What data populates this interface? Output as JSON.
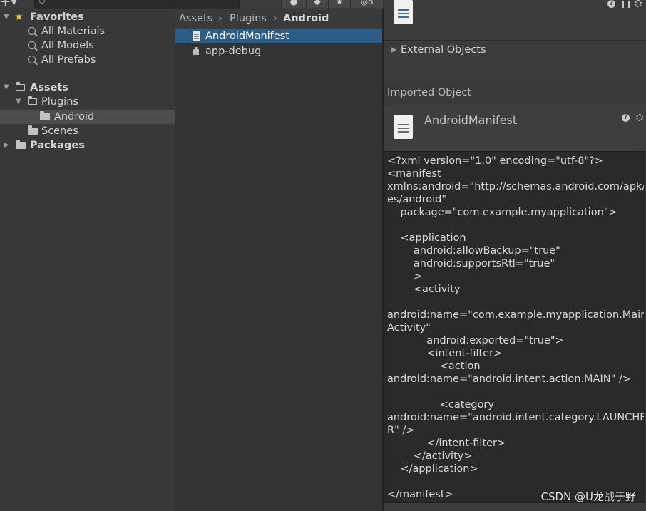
{
  "toolbar": {
    "add_label": "+▾",
    "hidden_count": "8"
  },
  "tree": {
    "favorites": {
      "label": "Favorites",
      "items": [
        "All Materials",
        "All Models",
        "All Prefabs"
      ]
    },
    "assets": {
      "label": "Assets",
      "plugins": "Plugins",
      "android": "Android",
      "scenes": "Scenes"
    },
    "packages": "Packages"
  },
  "breadcrumb": [
    "Assets",
    "Plugins",
    "Android"
  ],
  "files": [
    {
      "name": "AndroidManifest",
      "icon": "document-icon",
      "selected": true
    },
    {
      "name": "app-debug",
      "icon": "package-icon",
      "selected": false
    }
  ],
  "inspector": {
    "external_objects": "External Objects",
    "imported_object": "Imported Object",
    "asset_name": "AndroidManifest",
    "code_lines": [
      "<?xml version=\"1.0\" encoding=\"utf-8\"?>",
      "<manifest",
      "xmlns:android=\"http://schemas.android.com/apk/r",
      "es/android\"",
      "    package=\"com.example.myapplication\">",
      "",
      "    <application",
      "        android:allowBackup=\"true\"",
      "        android:supportsRtl=\"true\"",
      "        >",
      "        <activity",
      "",
      "android:name=\"com.example.myapplication.Main",
      "Activity\"",
      "            android:exported=\"true\">",
      "            <intent-filter>",
      "                <action",
      "android:name=\"android.intent.action.MAIN\" />",
      "",
      "                <category",
      "android:name=\"android.intent.category.LAUNCHE",
      "R\" />",
      "            </intent-filter>",
      "        </activity>",
      "    </application>",
      "",
      "</manifest>"
    ]
  },
  "watermark": "CSDN @U龙战于野",
  "colors": {
    "selection": "#2c5d87",
    "favorites_star": "#f5c518"
  }
}
